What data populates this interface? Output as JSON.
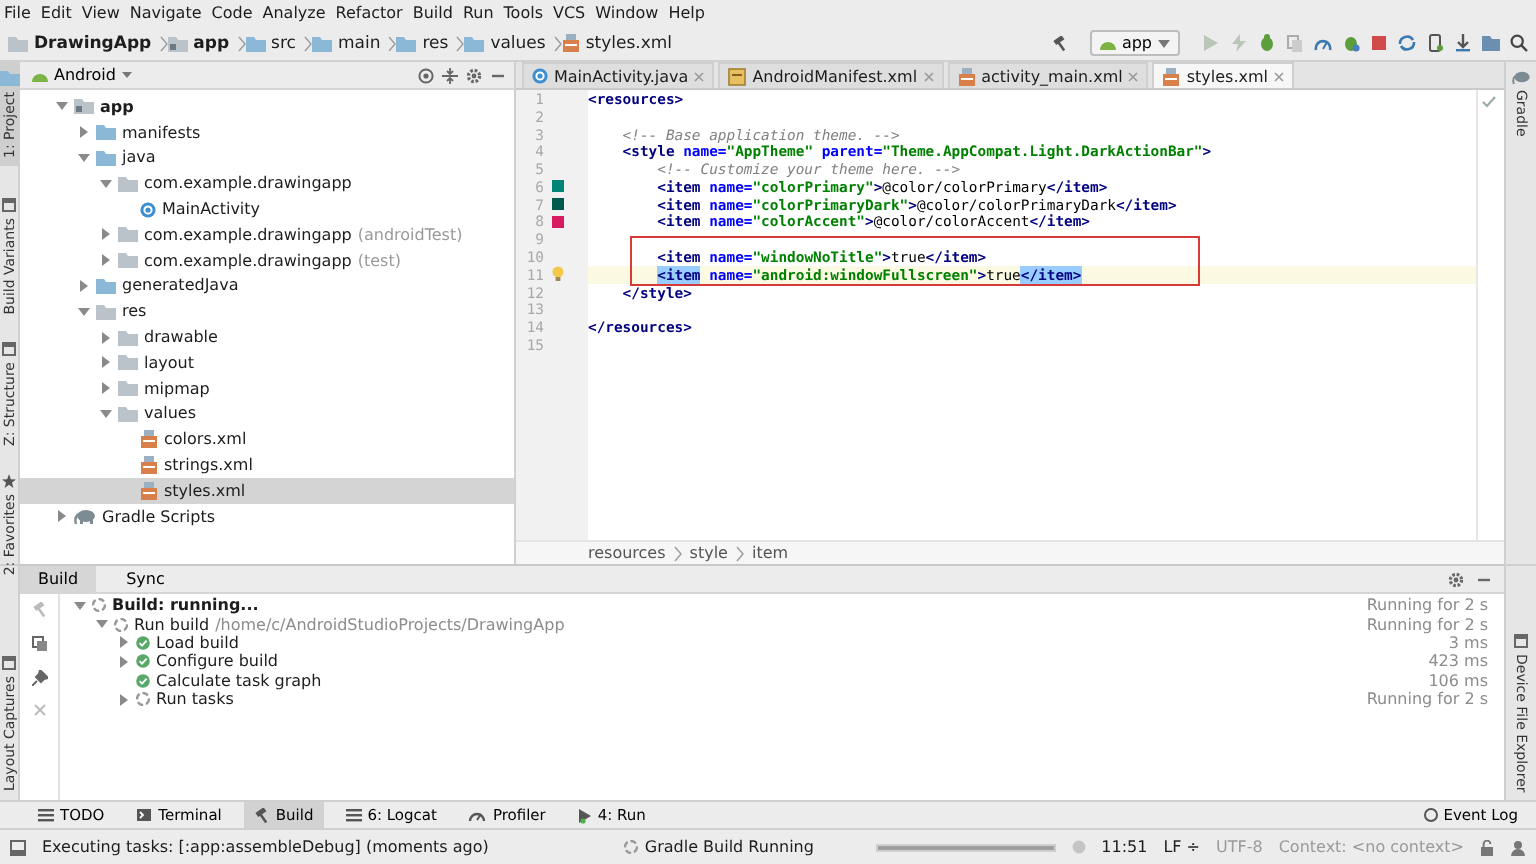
{
  "menu": [
    "File",
    "Edit",
    "View",
    "Navigate",
    "Code",
    "Analyze",
    "Refactor",
    "Build",
    "Run",
    "Tools",
    "VCS",
    "Window",
    "Help"
  ],
  "breadcrumbs": [
    {
      "label": "DrawingApp",
      "kind": "project"
    },
    {
      "label": "app",
      "kind": "module"
    },
    {
      "label": "src",
      "kind": "folder"
    },
    {
      "label": "main",
      "kind": "folder"
    },
    {
      "label": "res",
      "kind": "folder"
    },
    {
      "label": "values",
      "kind": "folder"
    },
    {
      "label": "styles.xml",
      "kind": "xml"
    }
  ],
  "run_config": "app",
  "left_tools": {
    "upper_top": [
      {
        "label": "1: Project",
        "kind": "folder",
        "selected": true
      }
    ],
    "upper_bottom": [
      {
        "label": "Build Variants",
        "kind": "panel",
        "selected": false
      },
      {
        "label": "Z: Structure",
        "kind": "panel",
        "selected": false
      },
      {
        "label": "2: Favorites",
        "kind": "star",
        "selected": false
      }
    ],
    "lower_bottom": [
      {
        "label": "Layout Captures",
        "kind": "panel",
        "selected": false
      }
    ]
  },
  "right_tools": {
    "upper_top": [
      {
        "label": "Gradle",
        "kind": "elephant"
      }
    ],
    "lower_bottom": [
      {
        "label": "Device File Explorer",
        "kind": "panel"
      }
    ]
  },
  "project_panel": {
    "view": "Android",
    "tree": [
      {
        "label": "app",
        "kind": "module",
        "expanded": true,
        "selected": false,
        "children": [
          {
            "label": "manifests",
            "kind": "folder",
            "expanded": false,
            "selected": false
          },
          {
            "label": "java",
            "kind": "folder",
            "expanded": true,
            "selected": false,
            "children": [
              {
                "label": "com.example.drawingapp",
                "kind": "package",
                "expanded": true,
                "selected": false,
                "children": [
                  {
                    "label": "MainActivity",
                    "kind": "class",
                    "selected": false
                  }
                ]
              },
              {
                "label": "com.example.drawingapp",
                "suffix": "(androidTest)",
                "kind": "package",
                "expanded": false,
                "selected": false
              },
              {
                "label": "com.example.drawingapp",
                "suffix": "(test)",
                "kind": "package",
                "expanded": false,
                "selected": false
              }
            ]
          },
          {
            "label": "generatedJava",
            "kind": "folder",
            "expanded": false,
            "selected": false
          },
          {
            "label": "res",
            "kind": "package",
            "expanded": true,
            "selected": false,
            "children": [
              {
                "label": "drawable",
                "kind": "package",
                "expanded": false,
                "selected": false
              },
              {
                "label": "layout",
                "kind": "package",
                "expanded": false,
                "selected": false
              },
              {
                "label": "mipmap",
                "kind": "package",
                "expanded": false,
                "selected": false
              },
              {
                "label": "values",
                "kind": "package",
                "expanded": true,
                "selected": false,
                "children": [
                  {
                    "label": "colors.xml",
                    "kind": "xml",
                    "selected": false
                  },
                  {
                    "label": "strings.xml",
                    "kind": "xml",
                    "selected": false
                  },
                  {
                    "label": "styles.xml",
                    "kind": "xml",
                    "selected": true
                  }
                ]
              }
            ]
          }
        ]
      },
      {
        "label": "Gradle Scripts",
        "kind": "gradle",
        "expanded": false,
        "selected": false
      }
    ]
  },
  "editor": {
    "tabs": [
      {
        "label": "MainActivity.java",
        "kind": "class",
        "selected": false
      },
      {
        "label": "AndroidManifest.xml",
        "kind": "manifest",
        "selected": false
      },
      {
        "label": "activity_main.xml",
        "kind": "xml",
        "selected": false
      },
      {
        "label": "styles.xml",
        "kind": "xml",
        "selected": true
      }
    ],
    "lines": [
      {
        "number": "1",
        "current": false,
        "intention": false,
        "tokens": [
          {
            "kind": "tag",
            "text": "<resources>"
          }
        ]
      },
      {
        "number": "2",
        "current": false,
        "intention": false
      },
      {
        "number": "3",
        "current": false,
        "intention": false,
        "tokens": [
          {
            "kind": "comment",
            "text": "    <!-- Base application theme. -->"
          }
        ]
      },
      {
        "number": "4",
        "current": false,
        "intention": false,
        "tokens": [
          {
            "kind": "tag",
            "text": "    <style "
          },
          {
            "kind": "attr",
            "text": "name="
          },
          {
            "kind": "value",
            "text": "\"AppTheme\""
          },
          {
            "kind": "attr",
            "text": " parent="
          },
          {
            "kind": "value",
            "text": "\"Theme.AppCompat.Light.DarkActionBar\""
          },
          {
            "kind": "tag",
            "text": ">"
          }
        ]
      },
      {
        "number": "5",
        "current": false,
        "intention": false,
        "tokens": [
          {
            "kind": "comment",
            "text": "        <!-- Customize your theme here. -->"
          }
        ]
      },
      {
        "number": "6",
        "current": false,
        "intention": false,
        "color": "#008577",
        "tokens": [
          {
            "kind": "tag",
            "text": "        <item "
          },
          {
            "kind": "attr",
            "text": "name="
          },
          {
            "kind": "value",
            "text": "\"colorPrimary\""
          },
          {
            "kind": "tag",
            "text": ">"
          },
          {
            "kind": "text",
            "text": "@color/colorPrimary"
          },
          {
            "kind": "tag",
            "text": "</item>"
          }
        ]
      },
      {
        "number": "7",
        "current": false,
        "intention": false,
        "color": "#00574b",
        "tokens": [
          {
            "kind": "tag",
            "text": "        <item "
          },
          {
            "kind": "attr",
            "text": "name="
          },
          {
            "kind": "value",
            "text": "\"colorPrimaryDark\""
          },
          {
            "kind": "tag",
            "text": ">"
          },
          {
            "kind": "text",
            "text": "@color/colorPrimaryDark"
          },
          {
            "kind": "tag",
            "text": "</item>"
          }
        ]
      },
      {
        "number": "8",
        "current": false,
        "intention": false,
        "color": "#d81b60",
        "tokens": [
          {
            "kind": "tag",
            "text": "        <item "
          },
          {
            "kind": "attr",
            "text": "name="
          },
          {
            "kind": "value",
            "text": "\"colorAccent\""
          },
          {
            "kind": "tag",
            "text": ">"
          },
          {
            "kind": "text",
            "text": "@color/colorAccent"
          },
          {
            "kind": "tag",
            "text": "</item>"
          }
        ]
      },
      {
        "number": "9",
        "current": false,
        "intention": false
      }
    ],
    "boxed_lines": [
      {
        "number": "10",
        "current": false,
        "intention": false,
        "tokens": [
          {
            "kind": "tag",
            "text": "        <item "
          },
          {
            "kind": "attr",
            "text": "name="
          },
          {
            "kind": "value",
            "text": "\"windowNoTitle\""
          },
          {
            "kind": "tag",
            "text": ">"
          },
          {
            "kind": "text",
            "text": "true"
          },
          {
            "kind": "tag",
            "text": "</item>"
          }
        ]
      },
      {
        "number": "11",
        "current": true,
        "intention": true,
        "tokens": [
          {
            "kind": "indentmatch",
            "text": "        <item"
          },
          {
            "kind": "attr",
            "text": " name="
          },
          {
            "kind": "value",
            "text": "\"android:windowFullscreen\""
          },
          {
            "kind": "tag",
            "text": ">"
          },
          {
            "kind": "text",
            "text": "true"
          },
          {
            "kind": "matchtag",
            "text": "</item>"
          }
        ]
      }
    ],
    "more_lines": [
      {
        "number": "12",
        "current": false,
        "intention": false,
        "tokens": [
          {
            "kind": "tag",
            "text": "    </style>"
          }
        ]
      },
      {
        "number": "13",
        "current": false,
        "intention": false
      },
      {
        "number": "14",
        "current": false,
        "intention": false,
        "tokens": [
          {
            "kind": "tag",
            "text": "</resources>"
          }
        ]
      },
      {
        "number": "15",
        "current": false,
        "intention": false
      }
    ],
    "breadcrumb": [
      "resources",
      "style",
      "item"
    ]
  },
  "build_panel": {
    "tabs": [
      {
        "label": "Build",
        "selected": true
      },
      {
        "label": "Sync",
        "selected": false
      }
    ],
    "tree": [
      {
        "label": "Build: running...",
        "kind": "running",
        "time": "Running for 2 s",
        "expanded": true,
        "children": [
          {
            "label": "Run build",
            "detail": "/home/c/AndroidStudioProjects/DrawingApp",
            "kind": "running",
            "time": "Running for 2 s",
            "expanded": true,
            "children": [
              {
                "label": "Load build",
                "kind": "done",
                "time": "3 ms",
                "expanded": false
              },
              {
                "label": "Configure build",
                "kind": "done",
                "time": "423 ms",
                "expanded": false
              },
              {
                "label": "Calculate task graph",
                "kind": "done",
                "time": "106 ms"
              },
              {
                "label": "Run tasks",
                "kind": "running",
                "time": "Running for 2 s",
                "expanded": false
              }
            ]
          }
        ]
      }
    ]
  },
  "tool_buttons": [
    {
      "label": "TODO",
      "kind": "list",
      "selected": false
    },
    {
      "label": "Terminal",
      "kind": "terminal",
      "selected": false
    },
    {
      "label": "Build",
      "kind": "hammer",
      "selected": true
    },
    {
      "label": "6: Logcat",
      "kind": "list",
      "selected": false
    },
    {
      "label": "Profiler",
      "kind": "gauge",
      "selected": false
    },
    {
      "label": "4: Run",
      "kind": "play",
      "selected": false
    }
  ],
  "event_log": "Event Log",
  "status_bar": {
    "message": "Executing tasks: [:app:assembleDebug] (moments ago)",
    "task": "Gradle Build Running",
    "progress": {
      "level": 1
    },
    "position": "11:51",
    "line_separator": "LF ÷",
    "encoding": "UTF-8",
    "context": "Context: <no context>"
  }
}
